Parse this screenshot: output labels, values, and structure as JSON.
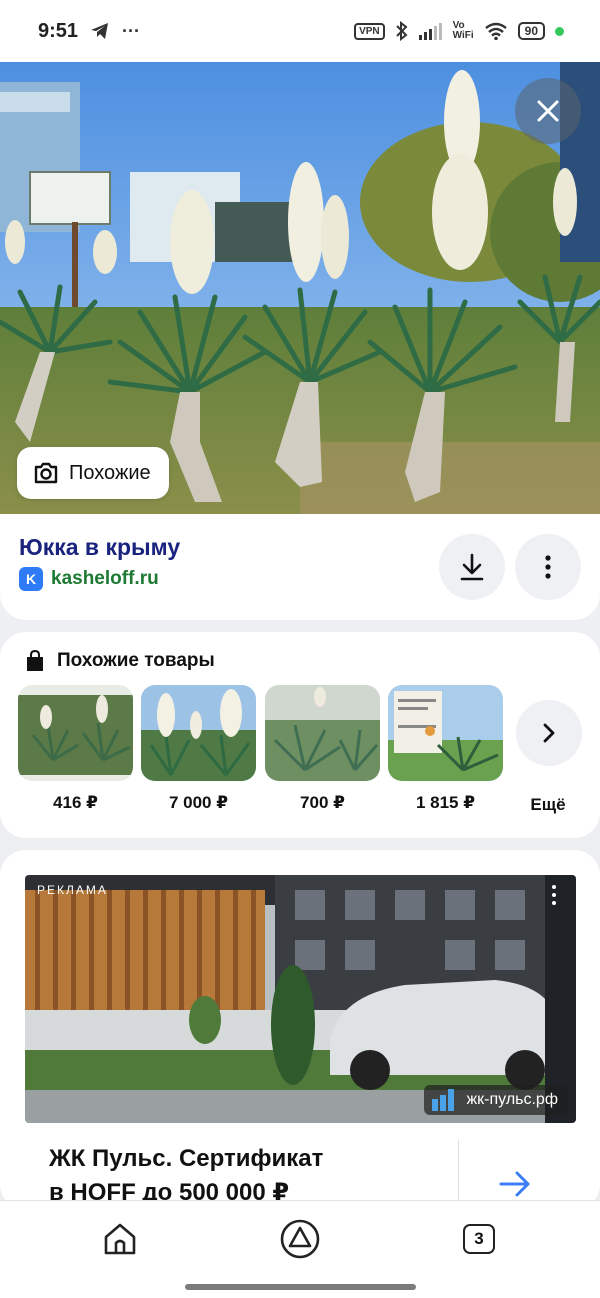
{
  "status_bar": {
    "time": "9:51",
    "vpn": "VPN",
    "vo": "Vo",
    "wifi": "WiFi",
    "battery": "90"
  },
  "result": {
    "similar_label": "Похожие",
    "title": "Юкка в крыму",
    "source_badge": "K",
    "source_domain": "kasheloff.ru"
  },
  "products": {
    "heading": "Похожие товары",
    "items": [
      {
        "price": "416 ₽"
      },
      {
        "price": "7 000 ₽"
      },
      {
        "price": "700 ₽"
      },
      {
        "price": "1 815 ₽"
      }
    ],
    "more_label": "Ещё"
  },
  "ad": {
    "label": "РЕКЛАМА",
    "domain": "жк-пульс.рф",
    "title_line1": "ЖК Пульс. Сертификат",
    "title_line2": "в HOFF до 500 000 ₽"
  },
  "bottom_nav": {
    "tab_count": "3"
  },
  "colors": {
    "title_blue": "#1a237e",
    "domain_green": "#1e7a33",
    "badge_blue": "#2f7bf5",
    "arrow_blue": "#3b7df6"
  }
}
